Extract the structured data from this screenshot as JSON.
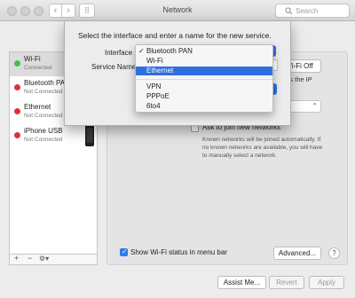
{
  "window": {
    "title": "Network"
  },
  "toolbar": {
    "search_placeholder": "Search"
  },
  "sidebar": {
    "items": [
      {
        "name": "Wi-Fi",
        "status": "Connected",
        "dot": "#3cc24a"
      },
      {
        "name": "Bluetooth PAN",
        "status": "Not Connected",
        "dot": "#e0303a"
      },
      {
        "name": "Ethernet",
        "status": "Not Connected",
        "dot": "#e0303a"
      },
      {
        "name": "iPhone USB",
        "status": "Not Connected",
        "dot": "#e0303a"
      }
    ],
    "toolbar": {
      "add": "+",
      "remove": "−",
      "action": "⚙▾"
    }
  },
  "panel": {
    "wifi_off_label": "Wi-Fi Off",
    "has_ip_text": "has the IP",
    "ask_join_label": "Ask to join new networks",
    "ask_join_checked": false,
    "known_networks_text": "Known networks will be joined automatically. If no known networks are available, you will have to manually select a network.",
    "show_status_label": "Show Wi-Fi status in menu bar",
    "show_status_checked": true,
    "advanced_label": "Advanced...",
    "help_label": "?"
  },
  "footer": {
    "assist_label": "Assist Me...",
    "revert_label": "Revert",
    "apply_label": "Apply"
  },
  "sheet": {
    "prompt": "Select the interface and enter a name for the new service.",
    "interface_label": "Interface",
    "service_name_label": "Service Name",
    "popup": {
      "items": [
        {
          "label": "Bluetooth PAN",
          "checked": true
        },
        {
          "label": "Wi-Fi",
          "checked": false
        },
        {
          "label": "Ethernet",
          "checked": false,
          "selected": true
        },
        {
          "label": "VPN",
          "checked": false
        },
        {
          "label": "PPPoE",
          "checked": false
        },
        {
          "label": "6to4",
          "checked": false
        }
      ],
      "check_glyph": "✓"
    }
  },
  "colors": {
    "accent": "#2f6fe0",
    "connected": "#3cc24a",
    "disconnected": "#e0303a"
  }
}
